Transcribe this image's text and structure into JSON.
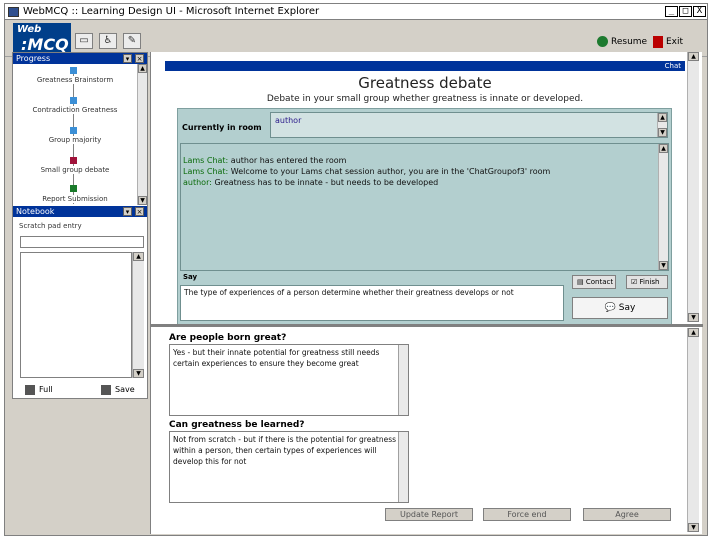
{
  "window": {
    "title": "WebMCQ :: Learning Design UI - Microsoft Internet Explorer",
    "minimize": "_",
    "maximize": "□",
    "close": "X"
  },
  "toolbar": {
    "logo_top": "Web",
    "logo_main": ":MCQ",
    "resume_label": "Resume",
    "exit_label": "Exit"
  },
  "progress": {
    "title": "Progress",
    "steps": [
      {
        "label": "Greatness Brainstorm",
        "color": "#3b8fd6"
      },
      {
        "label": "Contradiction Greatness",
        "color": "#3b8fd6"
      },
      {
        "label": "Group majority",
        "color": "#3b8fd6"
      },
      {
        "label": "Small group debate",
        "color": "#a0123a"
      },
      {
        "label": "Report Submission",
        "color": "#1a7a2a"
      }
    ]
  },
  "notebook": {
    "title": "Notebook",
    "scratch_label": "Scratch pad entry",
    "full_label": "Full",
    "save_label": "Save"
  },
  "chat": {
    "tab_label": "Chat",
    "title": "Greatness debate",
    "instructions": "Debate in your small group whether greatness is innate or developed.",
    "room_label": "Currently in room",
    "room_user": "author",
    "messages": [
      {
        "who": "Lams Chat:",
        "text": " author has entered the room"
      },
      {
        "who": "Lams Chat:",
        "text": " Welcome to your Lams chat session author, you are in the 'ChatGroupof3' room"
      },
      {
        "who": "author:",
        "text": " Greatness has to be innate - but needs to be developed"
      }
    ],
    "say_label": "Say",
    "say_text": "The type of experiences of a person determine whether their greatness develops or not",
    "contact_label": "Contact",
    "finish_label": "Finish",
    "say_button": "Say"
  },
  "report": {
    "q1_label": "Are people born great?",
    "q1_answer": "Yes - but their innate potential for greatness still needs certain experiences to ensure they become great",
    "q2_label": "Can greatness be learned?",
    "q2_answer": "Not from scratch - but if there is the potential for greatness within a person, then certain types of experiences will develop this for not",
    "update_button": "Update Report",
    "force_button": "Force end",
    "agree_button": "Agree"
  }
}
